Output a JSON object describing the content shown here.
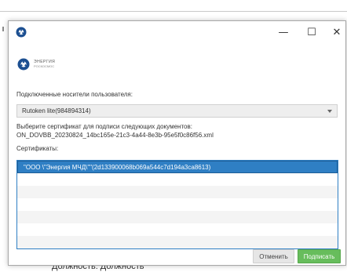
{
  "window": {
    "minimize_glyph": "—",
    "maximize_glyph": "☐",
    "close_glyph": "✕"
  },
  "brand": {
    "name": "ЭНЕРГИЯ",
    "subtitle": "РОСКОСМОС"
  },
  "carriers": {
    "label": "Подключенные носители пользователя:",
    "selected": "Rutoken lite(984894314)"
  },
  "documents": {
    "label": "Выберите сертификат для подписи следующих документов:",
    "filename": "ON_DOVBB_20230824_14bc165e-21c3-4a44-8e3b-95e5f0c86f56.xml"
  },
  "certificates": {
    "label": "Сертификаты:",
    "rows": [
      "\"ООО \\\"Энергия МЧД\\\"\"(2d133900068b069a544c7d194a3ca8613)",
      "",
      "",
      "",
      "",
      "",
      ""
    ]
  },
  "buttons": {
    "cancel": "Отменить",
    "sign": "Подписать"
  },
  "background": {
    "text": "Должность: Должность"
  },
  "colors": {
    "accent": "#2f7fc4",
    "sign_button": "#67bd5c",
    "logo_blue": "#1c4f91"
  },
  "icons": {
    "title_icon": "energia-logo-icon",
    "brand_icon": "energia-logo-icon"
  }
}
